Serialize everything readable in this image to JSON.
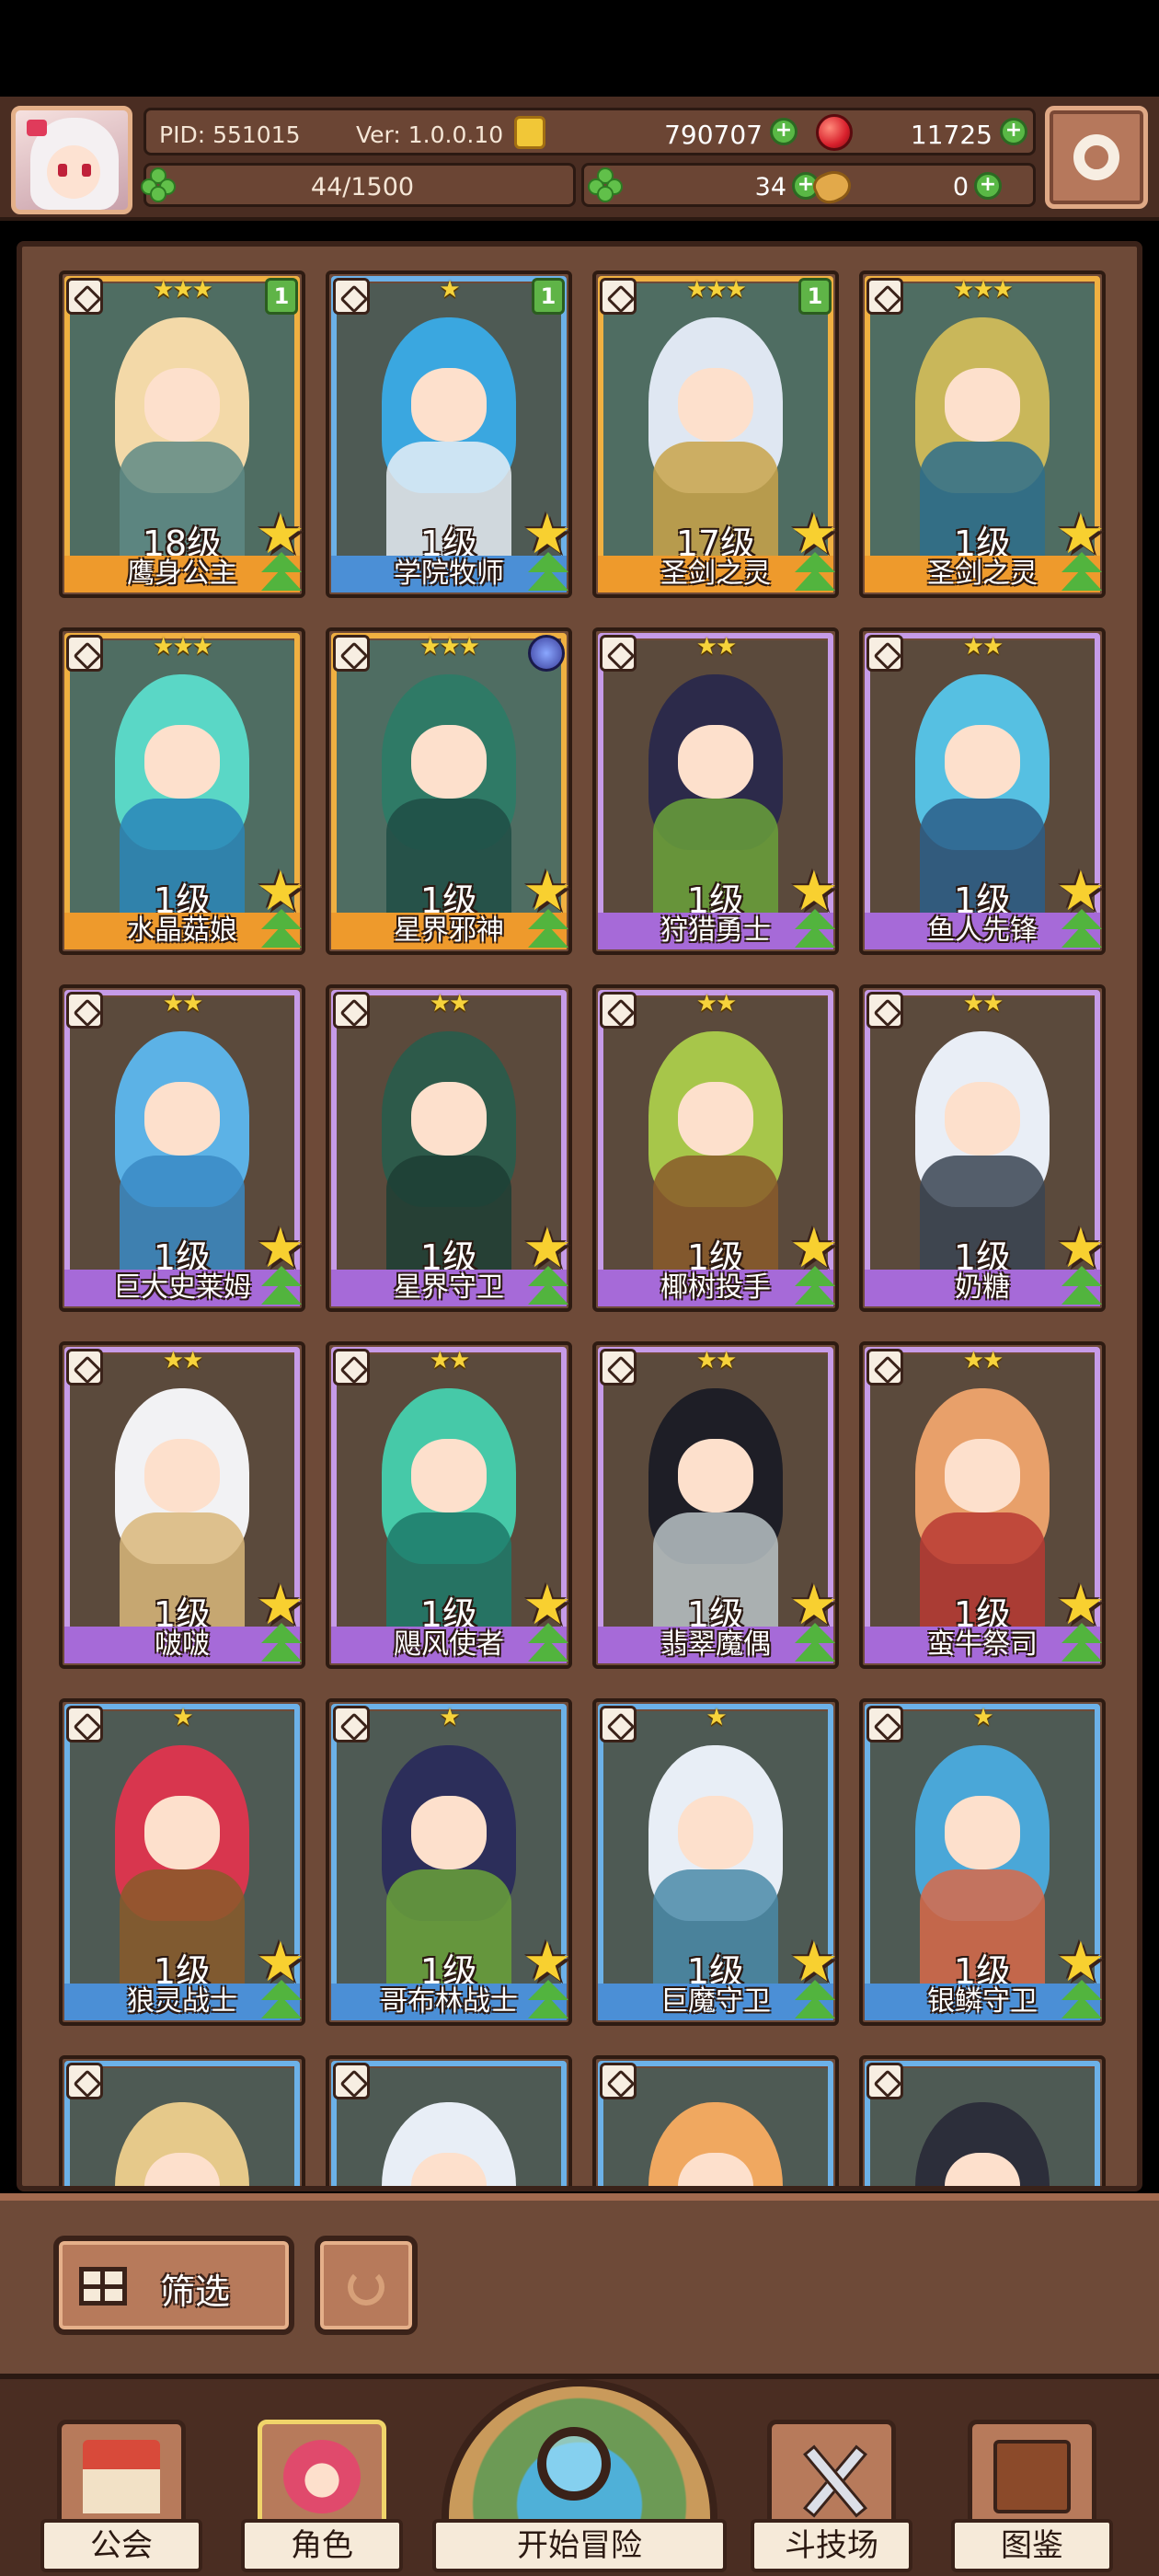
{
  "player": {
    "pid": "PID: 551015",
    "version": "Ver: 1.0.0.10",
    "gold": "790707",
    "gems": "11725",
    "exp": "44/1500",
    "clover": "34",
    "bread": "0"
  },
  "cards": [
    {
      "stars": "★★★",
      "level": "18级",
      "name": "鹰身公主",
      "rarity": "orange",
      "badge": "1",
      "hair": "#f3d9a8",
      "body": "#5e8a86"
    },
    {
      "stars": "★",
      "level": "1级",
      "name": "学院牧师",
      "rarity": "blue",
      "badge": "1",
      "hair": "#3aa7e0",
      "body": "#e8eef6"
    },
    {
      "stars": "★★★",
      "level": "17级",
      "name": "圣剑之灵",
      "rarity": "orange",
      "badge": "1",
      "hair": "#dfe7f2",
      "body": "#c9a34a"
    },
    {
      "stars": "★★★",
      "level": "1级",
      "name": "圣剑之灵",
      "rarity": "orange",
      "badge": "",
      "hair": "#c9b75a",
      "body": "#2e6e8c"
    },
    {
      "stars": "★★★",
      "level": "1级",
      "name": "水晶菇娘",
      "rarity": "orange",
      "badge": "",
      "hair": "#5ad7c6",
      "body": "#2a86b8"
    },
    {
      "stars": "★★★",
      "level": "1级",
      "name": "星界邪神",
      "rarity": "orange",
      "badge": "orb",
      "hair": "#2f7a66",
      "body": "#1f4d45"
    },
    {
      "stars": "★★",
      "level": "1级",
      "name": "狩猎勇士",
      "rarity": "purple",
      "badge": "",
      "hair": "#2c2a4a",
      "body": "#6aa13a"
    },
    {
      "stars": "★★",
      "level": "1级",
      "name": "鱼人先锋",
      "rarity": "purple",
      "badge": "",
      "hair": "#56c0e2",
      "body": "#2c5e88"
    },
    {
      "stars": "★★",
      "level": "1级",
      "name": "巨大史莱姆",
      "rarity": "purple",
      "badge": "",
      "hair": "#5cb2e6",
      "body": "#3a8ac4"
    },
    {
      "stars": "★★",
      "level": "1级",
      "name": "星界守卫",
      "rarity": "purple",
      "badge": "",
      "hair": "#2d5a4a",
      "body": "#1d3e34"
    },
    {
      "stars": "★★",
      "level": "1级",
      "name": "椰树投手",
      "rarity": "purple",
      "badge": "",
      "hair": "#a7c64a",
      "body": "#8a5a2a"
    },
    {
      "stars": "★★",
      "level": "1级",
      "name": "奶糖",
      "rarity": "purple",
      "badge": "",
      "hair": "#e9eef6",
      "body": "#3a4452"
    },
    {
      "stars": "★★",
      "level": "1级",
      "name": "啵啵",
      "rarity": "purple",
      "badge": "",
      "hair": "#f2f2f4",
      "body": "#d9b77a"
    },
    {
      "stars": "★★",
      "level": "1级",
      "name": "飓风使者",
      "rarity": "purple",
      "badge": "",
      "hair": "#46c9a8",
      "body": "#1d7a6a"
    },
    {
      "stars": "★★",
      "level": "1级",
      "name": "翡翠魔偶",
      "rarity": "purple",
      "badge": "",
      "hair": "#1e1e26",
      "body": "#b8c2c6"
    },
    {
      "stars": "★★",
      "level": "1级",
      "name": "蛮牛祭司",
      "rarity": "purple",
      "badge": "",
      "hair": "#e8a06a",
      "body": "#b83a32"
    },
    {
      "stars": "★",
      "level": "1级",
      "name": "狼灵战士",
      "rarity": "blue",
      "badge": "",
      "hair": "#d8364e",
      "body": "#8a5a2a"
    },
    {
      "stars": "★",
      "level": "1级",
      "name": "哥布林战士",
      "rarity": "blue",
      "badge": "",
      "hair": "#2c2e5a",
      "body": "#6aa13a"
    },
    {
      "stars": "★",
      "level": "1级",
      "name": "巨魔守卫",
      "rarity": "blue",
      "badge": "",
      "hair": "#e8eef6",
      "body": "#4a8aa8"
    },
    {
      "stars": "★",
      "level": "1级",
      "name": "银鳞守卫",
      "rarity": "blue",
      "badge": "",
      "hair": "#4aa7d8",
      "body": "#d86a4a"
    },
    {
      "stars": "",
      "level": "",
      "name": "",
      "rarity": "blue",
      "badge": "",
      "hair": "#e6c98a",
      "body": "#5e8a86"
    },
    {
      "stars": "",
      "level": "",
      "name": "",
      "rarity": "blue",
      "badge": "",
      "hair": "#e8eef6",
      "body": "#c8a0aa"
    },
    {
      "stars": "",
      "level": "",
      "name": "",
      "rarity": "blue",
      "badge": "",
      "hair": "#f0a860",
      "body": "#b8804a"
    },
    {
      "stars": "",
      "level": "",
      "name": "",
      "rarity": "blue",
      "badge": "",
      "hair": "#2c2e3a",
      "body": "#f0c860"
    }
  ],
  "toolbar": {
    "filter_label": "筛选"
  },
  "nav": {
    "guild": "公会",
    "character": "角色",
    "adventure": "开始冒险",
    "arena": "斗技场",
    "codex": "图鉴"
  },
  "icons": {
    "settings": "gear-icon",
    "gold": "coin-icon",
    "gems": "ruby-icon",
    "exp": "clover-icon",
    "bread": "bread-icon"
  },
  "colors": {
    "panel_bg": "#6e4a38",
    "frame_orange": "#f0b041",
    "frame_blue": "#6cb1e8",
    "frame_purple": "#c69be8",
    "plus_green": "#59b845"
  }
}
